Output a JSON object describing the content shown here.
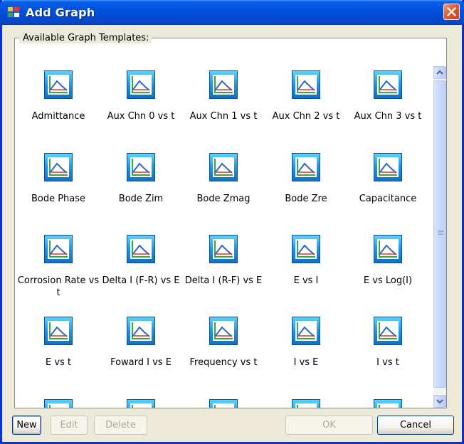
{
  "window": {
    "title": "Add Graph"
  },
  "group": {
    "label": "Available Graph Templates:"
  },
  "templates": [
    "Admittance",
    "Aux Chn 0 vs t",
    "Aux Chn 1 vs t",
    "Aux Chn 2 vs t",
    "Aux Chn 3 vs t",
    "Bode Phase",
    "Bode Zim",
    "Bode Zmag",
    "Bode Zre",
    "Capacitance",
    "Corrosion Rate vs t",
    "Delta I (F-R) vs E",
    "Delta I (R-F) vs E",
    "E vs I",
    "E vs Log(I)",
    "E vs t",
    "Foward I vs E",
    "Frequency vs t",
    "I vs E",
    "I vs t"
  ],
  "buttons": {
    "new": "New",
    "edit": "Edit",
    "delete": "Delete",
    "ok": "OK",
    "cancel": "Cancel"
  },
  "icons": {
    "template": "graph-template-icon",
    "app": "app-icon",
    "close": "close-icon"
  },
  "colors": {
    "titlebar": "#0054e3",
    "window_border": "#0831d9",
    "close_button": "#e25a2e"
  }
}
